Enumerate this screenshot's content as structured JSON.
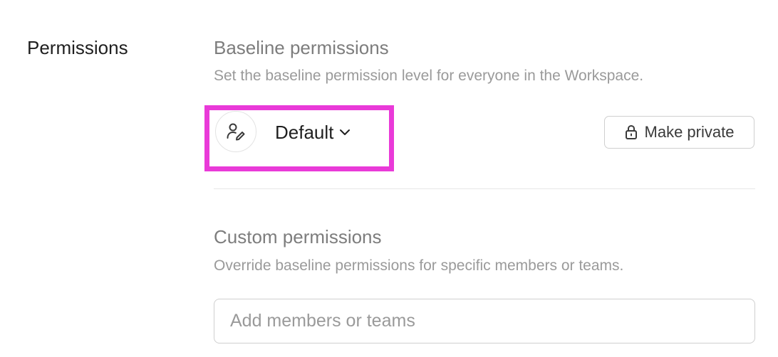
{
  "section": {
    "label": "Permissions"
  },
  "baseline": {
    "title": "Baseline permissions",
    "description": "Set the baseline permission level for everyone in the Workspace.",
    "role_icon": "person-edit-icon",
    "role_value": "Default",
    "dropdown_icon": "chevron-down-icon",
    "make_private_icon": "lock-icon",
    "make_private_label": "Make private",
    "highlight_color": "#e93ad8"
  },
  "custom": {
    "title": "Custom permissions",
    "description": "Override baseline permissions for specific members or teams.",
    "input_placeholder": "Add members or teams"
  }
}
